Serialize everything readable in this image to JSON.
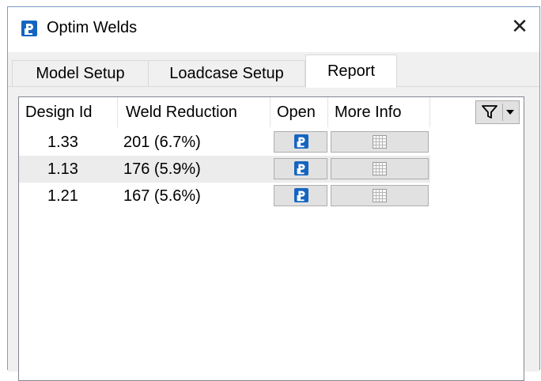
{
  "window": {
    "title": "Optim Welds",
    "close_glyph": "✕",
    "app_icon": "optim-app-icon"
  },
  "tabs": [
    {
      "label": "Model Setup",
      "active": false
    },
    {
      "label": "Loadcase Setup",
      "active": false
    },
    {
      "label": "Report",
      "active": true
    }
  ],
  "table": {
    "columns": [
      "Design Id",
      "Weld Reduction",
      "Open",
      "More Info"
    ],
    "rows": [
      {
        "design_id": "1.33",
        "weld_reduction": "201 (6.7%)"
      },
      {
        "design_id": "1.13",
        "weld_reduction": "176 (5.9%)"
      },
      {
        "design_id": "1.21",
        "weld_reduction": "167 (5.6%)"
      }
    ],
    "icons": {
      "open": "optim-app-icon",
      "more_info": "grid-icon",
      "filter": "funnel-icon"
    }
  },
  "colors": {
    "accent": "#1565c0",
    "button_bg": "#e1e1e1",
    "alt_row": "#ececec",
    "panel_bg": "#f0f0f0"
  }
}
